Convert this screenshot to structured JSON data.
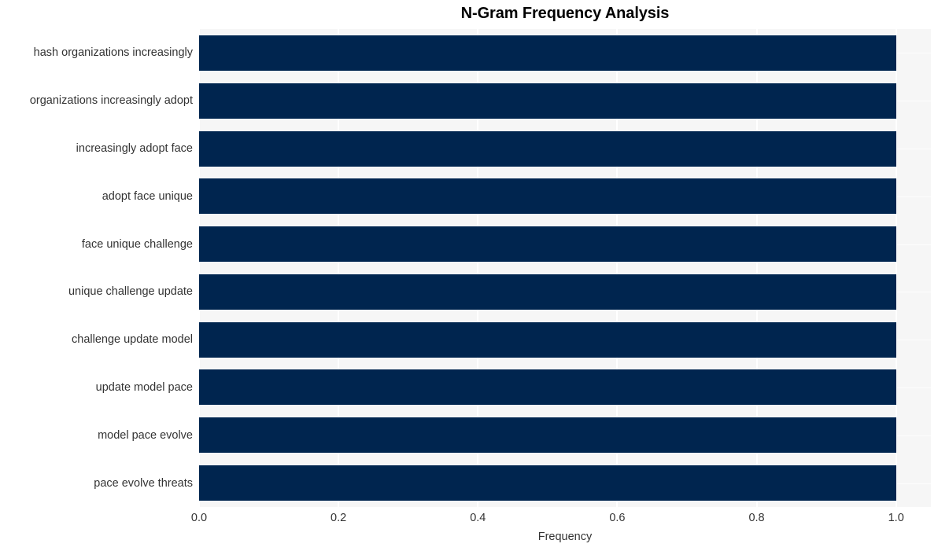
{
  "chart_data": {
    "type": "bar",
    "orientation": "horizontal",
    "title": "N-Gram Frequency Analysis",
    "xlabel": "Frequency",
    "ylabel": "",
    "xlim": [
      0.0,
      1.05
    ],
    "xticks": [
      "0.0",
      "0.2",
      "0.4",
      "0.6",
      "0.8",
      "1.0"
    ],
    "xtick_values": [
      0.0,
      0.2,
      0.4,
      0.6,
      0.8,
      1.0
    ],
    "grid": true,
    "legend": "none",
    "categories": [
      "hash organizations increasingly",
      "organizations increasingly adopt",
      "increasingly adopt face",
      "adopt face unique",
      "face unique challenge",
      "unique challenge update",
      "challenge update model",
      "update model pace",
      "model pace evolve",
      "pace evolve threats"
    ],
    "values": [
      1.0,
      1.0,
      1.0,
      1.0,
      1.0,
      1.0,
      1.0,
      1.0,
      1.0,
      1.0
    ],
    "bar_color": "#00254f",
    "plot_background": "#f6f6f6",
    "figure_background": "#ffffff",
    "gridline_color": "#ffffff",
    "text_color": "#333333",
    "title_color": "#000000"
  }
}
